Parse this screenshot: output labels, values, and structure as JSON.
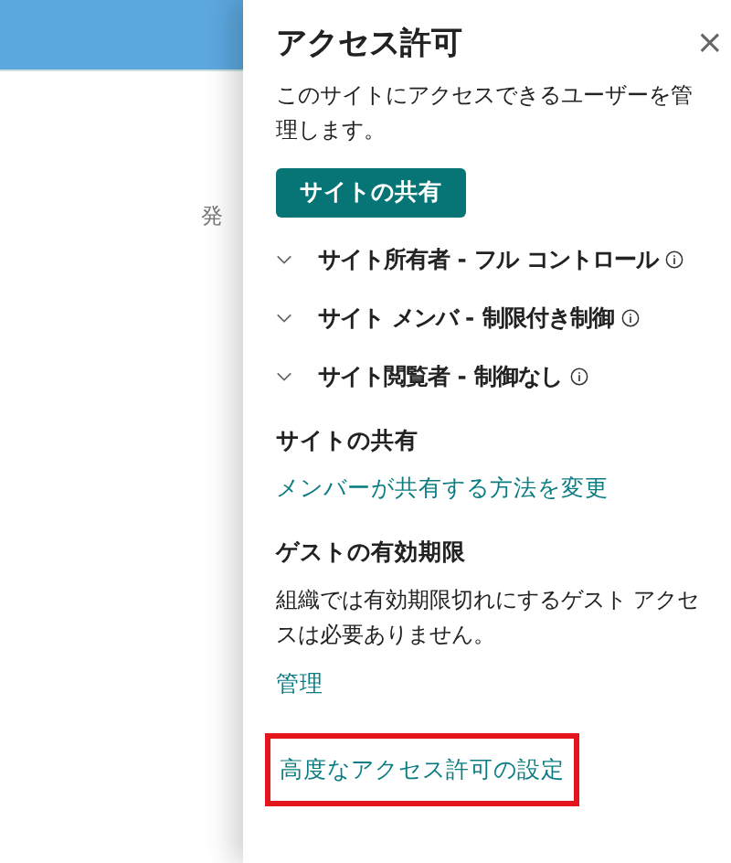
{
  "background": {
    "text": "発"
  },
  "panel": {
    "title": "アクセス許可",
    "close": "×",
    "description": "このサイトにアクセスできるユーザーを管理します。",
    "share_button": "サイトの共有",
    "groups": [
      {
        "label": "サイト所有者 - フル コントロール",
        "expanded": false
      },
      {
        "label": "サイト メンバ - 制限付き制御",
        "expanded": false
      },
      {
        "label": "サイト閲覧者 - 制御なし",
        "expanded": false
      }
    ],
    "sections": [
      {
        "heading": "サイトの共有",
        "link": "メンバーが共有する方法を変更"
      },
      {
        "heading": "ゲストの有効期限",
        "text": "組織では有効期限切れにするゲスト アクセスは必要ありません。",
        "link": "管理"
      }
    ],
    "advanced_link": {
      "label": "高度なアクセス許可の設定",
      "highlighted": true
    }
  }
}
